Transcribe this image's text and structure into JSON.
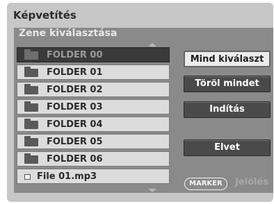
{
  "window": {
    "title": "Képvetítés"
  },
  "panel": {
    "subtitle": "Zene kiválasztása"
  },
  "list": {
    "items": [
      {
        "label": "FOLDER 00",
        "type": "folder",
        "selected": true
      },
      {
        "label": "FOLDER 01",
        "type": "folder",
        "selected": false
      },
      {
        "label": "FOLDER 02",
        "type": "folder",
        "selected": false
      },
      {
        "label": "FOLDER 03",
        "type": "folder",
        "selected": false
      },
      {
        "label": "FOLDER 04",
        "type": "folder",
        "selected": false
      },
      {
        "label": "FOLDER 05",
        "type": "folder",
        "selected": false
      },
      {
        "label": "FOLDER 06",
        "type": "folder",
        "selected": false
      },
      {
        "label": "File 01.mp3",
        "type": "file",
        "selected": false
      }
    ]
  },
  "buttons": {
    "select_all": "Mind kiválaszt",
    "delete_all": "Töröl mindet",
    "start": "Indítás",
    "cancel": "Elvet"
  },
  "marker": {
    "badge": "MARKER",
    "label": "Jelölés"
  },
  "colors": {
    "selected_row": "#3a3a3a",
    "panel_bg": "#8a8a8a",
    "dark_button": "#4a4a4a"
  }
}
